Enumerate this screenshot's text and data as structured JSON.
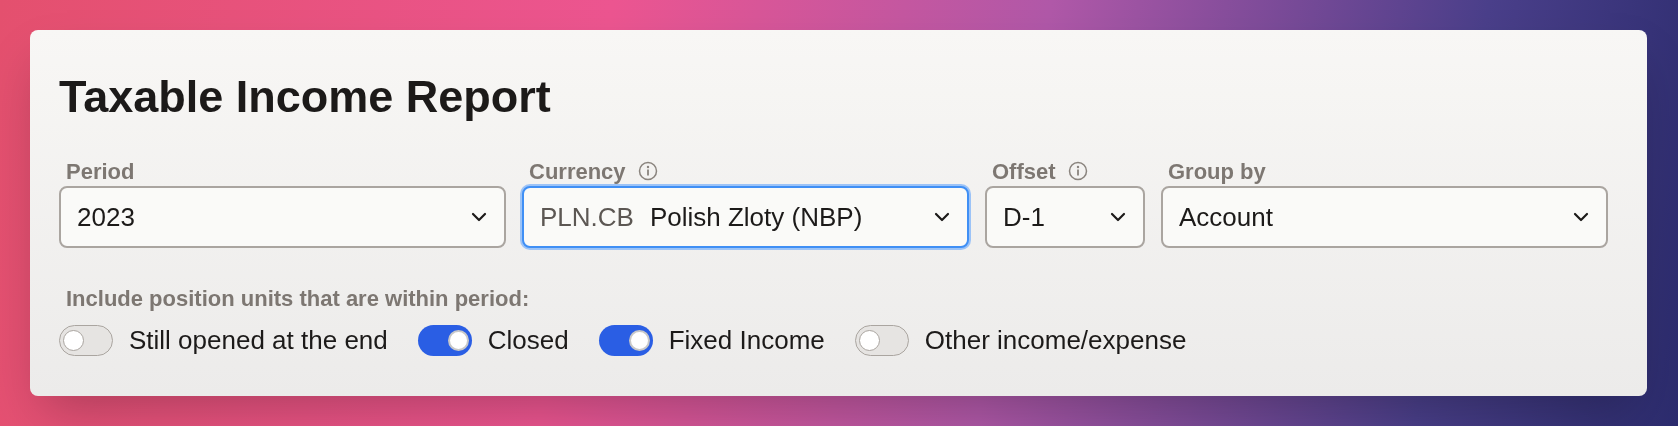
{
  "title": "Taxable Income Report",
  "fields": [
    {
      "label": "Period",
      "info": false,
      "value": "2023",
      "focused": false,
      "kind": "wide"
    },
    {
      "label": "Currency",
      "info": true,
      "code": "PLN.CB",
      "value": "Polish Zloty (NBP)",
      "focused": true,
      "kind": "wide"
    },
    {
      "label": "Offset",
      "info": true,
      "value": "D-1",
      "focused": false,
      "kind": "narrow"
    },
    {
      "label": "Group by",
      "info": false,
      "value": "Account",
      "focused": false,
      "kind": "wide"
    }
  ],
  "include_label": "Include position units that are within period:",
  "toggles": [
    {
      "label": "Still opened at the end",
      "on": false
    },
    {
      "label": "Closed",
      "on": true
    },
    {
      "label": "Fixed Income",
      "on": true
    },
    {
      "label": "Other income/expense",
      "on": false
    }
  ]
}
